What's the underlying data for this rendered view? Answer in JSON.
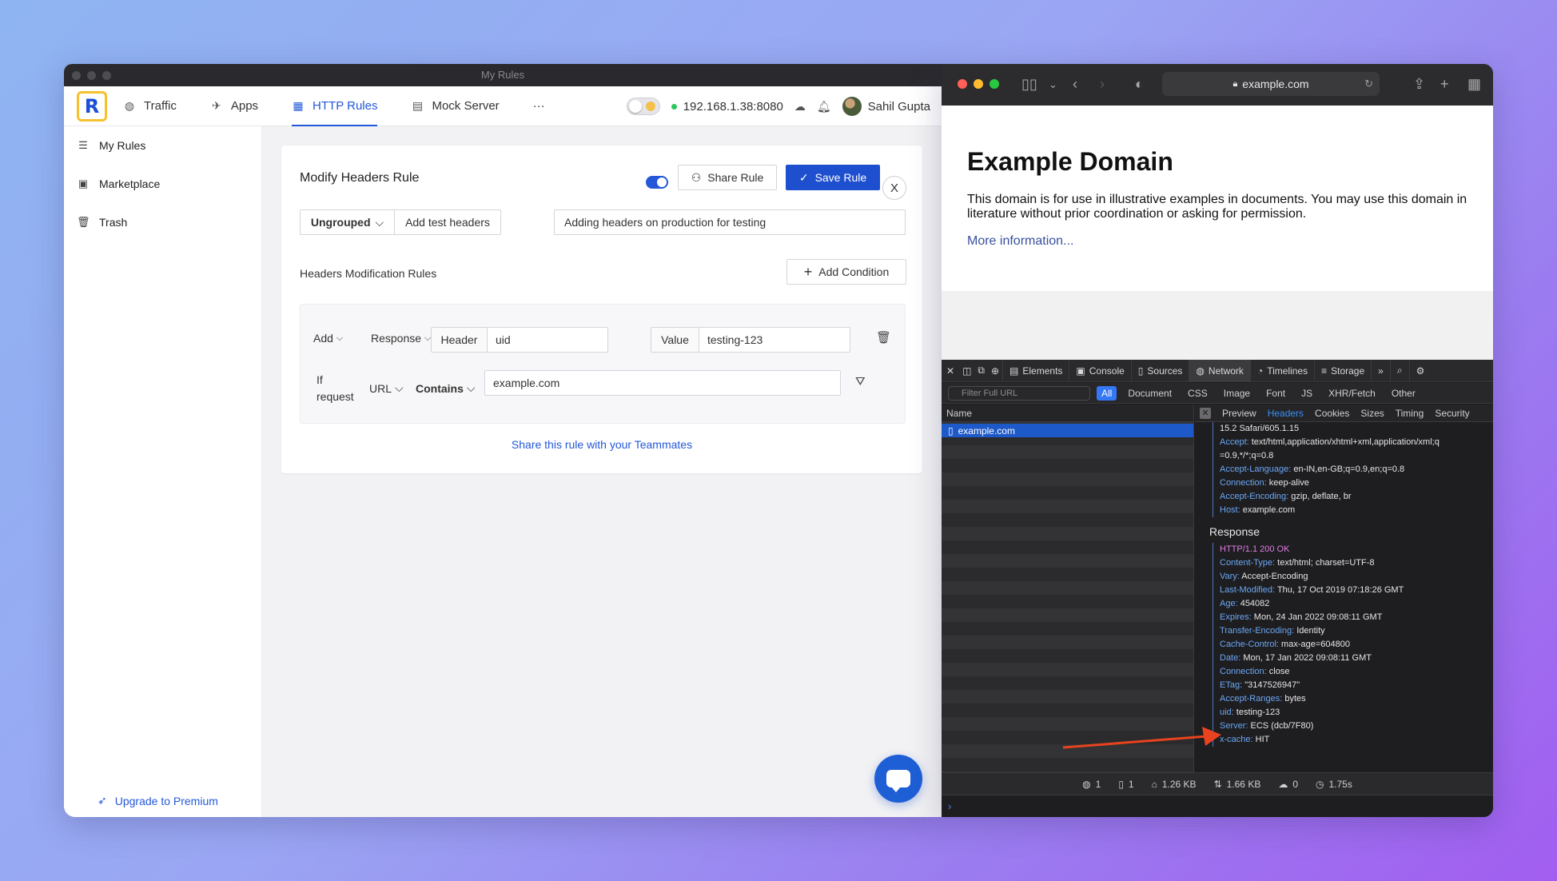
{
  "left_window": {
    "title": "My Rules",
    "nav": {
      "items": [
        {
          "label": "Traffic",
          "icon": "globe-icon"
        },
        {
          "label": "Apps",
          "icon": "rocket-icon"
        },
        {
          "label": "HTTP Rules",
          "icon": "rules-icon",
          "active": true
        },
        {
          "label": "Mock Server",
          "icon": "server-icon"
        }
      ],
      "more": "···",
      "ip": "192.168.1.38:8080",
      "user": "Sahil Gupta"
    },
    "sidebar": {
      "items": [
        {
          "label": "My Rules",
          "icon": "list-icon"
        },
        {
          "label": "Marketplace",
          "icon": "store-icon"
        },
        {
          "label": "Trash",
          "icon": "trash-icon"
        }
      ],
      "upgrade": "Upgrade to Premium"
    },
    "rule": {
      "title": "Modify Headers Rule",
      "share_label": "Share Rule",
      "save_label": "Save Rule",
      "close_label": "X",
      "group": "Ungrouped",
      "name": "Add test headers",
      "description": "Adding headers on production for testing",
      "section_label": "Headers Modification Rules",
      "add_condition": "Add Condition",
      "action": "Add",
      "target": "Response",
      "header_label": "Header",
      "header_value": "uid",
      "value_label": "Value",
      "value_value": "testing-123",
      "if_label_1": "If",
      "if_label_2": "request",
      "match_key": "URL",
      "match_op": "Contains",
      "match_value": "example.com",
      "share_link": "Share this rule with your Teammates"
    }
  },
  "right_window": {
    "url": "example.com",
    "page": {
      "heading": "Example Domain",
      "paragraph": "This domain is for use in illustrative examples in documents. You may use this domain in literature without prior coordination or asking for permission.",
      "link": "More information..."
    },
    "devtools": {
      "tabs": [
        "Elements",
        "Console",
        "Sources",
        "Network",
        "Timelines",
        "Storage"
      ],
      "filter_placeholder": "Filter Full URL",
      "types": [
        "All",
        "Document",
        "CSS",
        "Image",
        "Font",
        "JS",
        "XHR/Fetch",
        "Other"
      ],
      "list_header": "Name",
      "request": "example.com",
      "detail_tabs": [
        "Preview",
        "Headers",
        "Cookies",
        "Sizes",
        "Timing",
        "Security"
      ],
      "request_headers": [
        {
          "k": "",
          "v": "15.2 Safari/605.1.15"
        },
        {
          "k": "Accept:",
          "v": "text/html,application/xhtml+xml,application/xml;q"
        },
        {
          "k": "",
          "v": "=0.9,*/*;q=0.8"
        },
        {
          "k": "Accept-Language:",
          "v": "en-IN,en-GB;q=0.9,en;q=0.8"
        },
        {
          "k": "Connection:",
          "v": "keep-alive"
        },
        {
          "k": "Accept-Encoding:",
          "v": "gzip, deflate, br"
        },
        {
          "k": "Host:",
          "v": "example.com"
        }
      ],
      "response_title": "Response",
      "response_status": "HTTP/1.1 200 OK",
      "response_headers": [
        {
          "k": "Content-Type:",
          "v": "text/html; charset=UTF-8"
        },
        {
          "k": "Vary:",
          "v": "Accept-Encoding"
        },
        {
          "k": "Last-Modified:",
          "v": "Thu, 17 Oct 2019 07:18:26 GMT"
        },
        {
          "k": "Age:",
          "v": "454082"
        },
        {
          "k": "Expires:",
          "v": "Mon, 24 Jan 2022 09:08:11 GMT"
        },
        {
          "k": "Transfer-Encoding:",
          "v": "Identity"
        },
        {
          "k": "Cache-Control:",
          "v": "max-age=604800"
        },
        {
          "k": "Date:",
          "v": "Mon, 17 Jan 2022 09:08:11 GMT"
        },
        {
          "k": "Connection:",
          "v": "close"
        },
        {
          "k": "ETag:",
          "v": "\"3147526947\""
        },
        {
          "k": "Accept-Ranges:",
          "v": "bytes"
        },
        {
          "k": "uid:",
          "v": "testing-123"
        },
        {
          "k": "Server:",
          "v": "ECS (dcb/7F80)"
        },
        {
          "k": "x-cache:",
          "v": "HIT"
        }
      ],
      "status": [
        {
          "icon": "globe-icon",
          "value": "1"
        },
        {
          "icon": "document-icon",
          "value": "1"
        },
        {
          "icon": "weight-icon",
          "value": "1.26 KB"
        },
        {
          "icon": "transfer-icon",
          "value": "1.66 KB"
        },
        {
          "icon": "cloud-icon",
          "value": "0"
        },
        {
          "icon": "clock-icon",
          "value": "1.75s"
        }
      ],
      "console_prompt": "›"
    }
  }
}
